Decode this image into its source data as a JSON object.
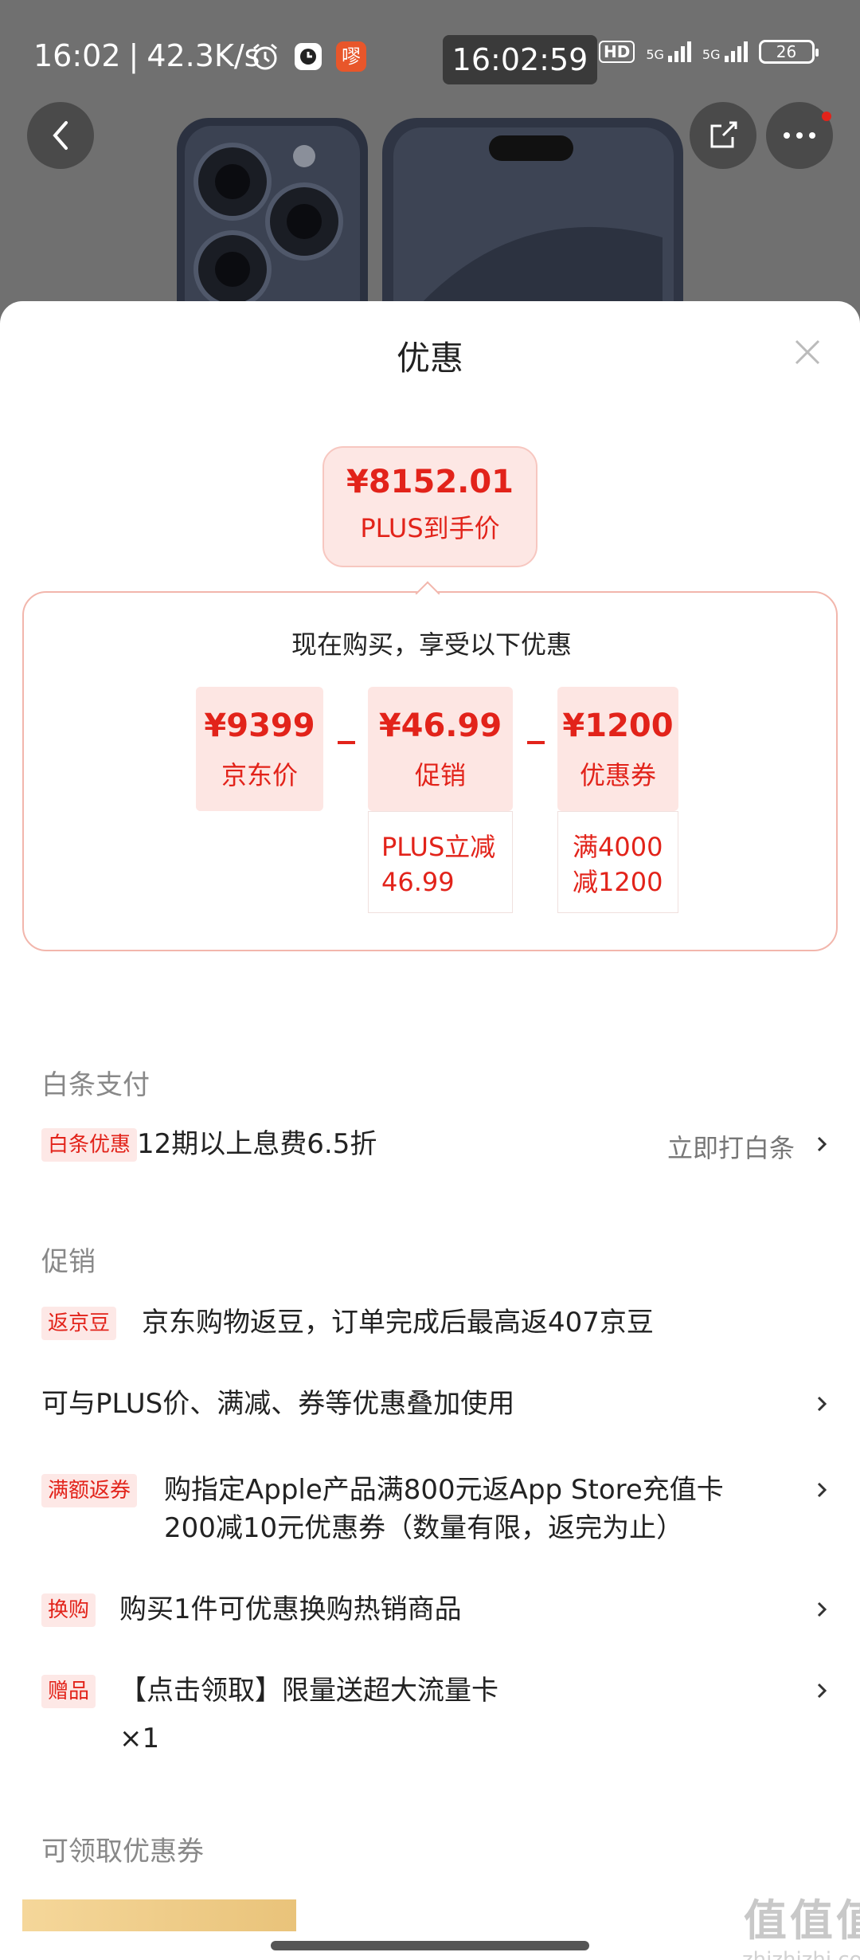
{
  "status_bar": {
    "time": "16:02",
    "speed": "42.3K/s",
    "center_clock": "16:02:59",
    "battery": "26",
    "hd_label": "HD",
    "net_label_1": "5G",
    "net_label_2": "5G",
    "app_badge": "嘐"
  },
  "sheet": {
    "title": "优惠",
    "final_price": "¥8152.01",
    "final_label": "PLUS到手价",
    "calc_heading": "现在购买，享受以下优惠",
    "terms": [
      {
        "value": "¥9399",
        "label": "京东价",
        "detail": ""
      },
      {
        "value": "¥46.99",
        "label": "促销",
        "detail_1": "PLUS立减",
        "detail_2": "46.99"
      },
      {
        "value": "¥1200",
        "label": "优惠券",
        "detail_1": "满4000",
        "detail_2": "减1200"
      }
    ]
  },
  "baitiao": {
    "section": "白条支付",
    "tag": "白条优惠",
    "text": "12期以上息费6.5折",
    "action": "立即打白条"
  },
  "promo": {
    "section": "促销",
    "items": [
      {
        "tag": "返京豆",
        "text": "京东购物返豆，订单完成后最高返407京豆"
      },
      {
        "tag": "",
        "text": "可与PLUS价、满减、券等优惠叠加使用"
      },
      {
        "tag": "满额返券",
        "text_1": "购指定Apple产品满800元返App Store充值卡",
        "text_2": "200减10元优惠券（数量有限，返完为止）"
      },
      {
        "tag": "换购",
        "text": "购买1件可优惠换购热销商品"
      },
      {
        "tag": "赠品",
        "text_1": "【点击领取】限量送超大流量卡",
        "text_2": "×1"
      }
    ]
  },
  "coupons": {
    "section": "可领取优惠券"
  },
  "watermark": {
    "logo": "值值值",
    "site": "zhizhizhi.com"
  }
}
